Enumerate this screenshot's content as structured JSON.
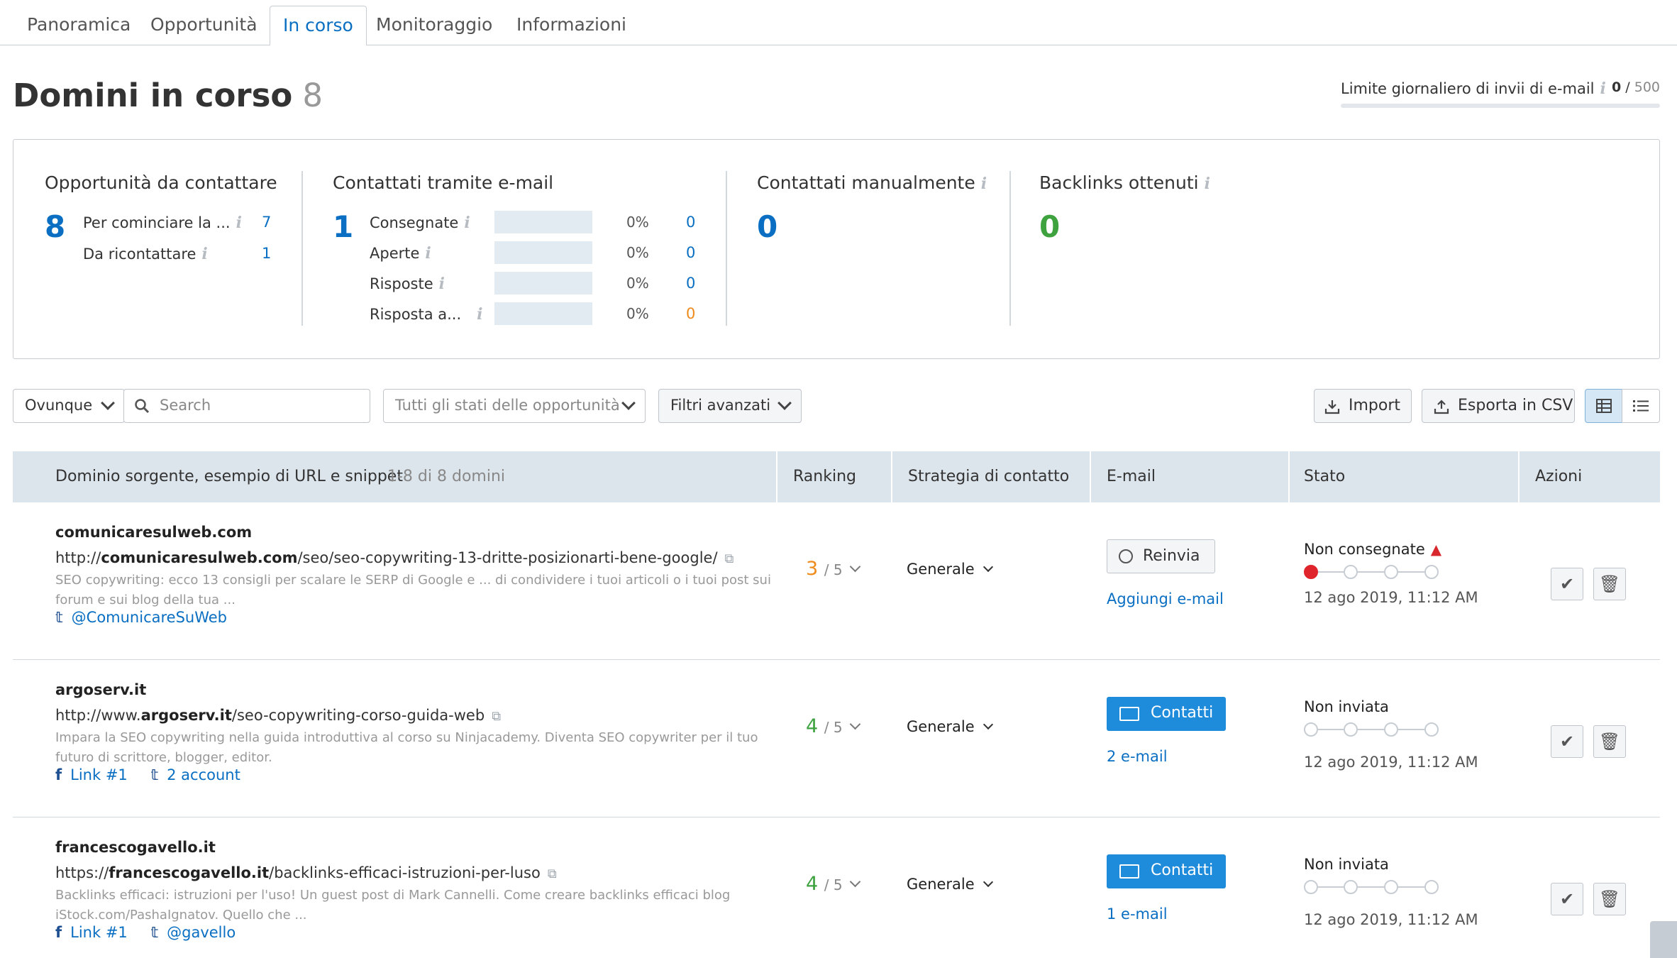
{
  "tabs": [
    "Panoramica",
    "Opportunità",
    "In corso",
    "Monitoraggio",
    "Informazioni"
  ],
  "active_tab": "In corso",
  "header": {
    "title": "Domini in corso",
    "count": "8"
  },
  "email_limit": {
    "label": "Limite giornaliero di invii di e-mail",
    "used": "0",
    "separator": "/",
    "total": "500",
    "progress": 0
  },
  "summary": {
    "opportunities": {
      "title": "Opportunità da contattare",
      "count": "8",
      "rows": [
        {
          "label": "Per cominciare la ...",
          "value": "7"
        },
        {
          "label": "Da ricontattare",
          "value": "1"
        }
      ]
    },
    "email_contacted": {
      "title": "Contattati tramite e-mail",
      "count": "1",
      "rows": [
        {
          "label": "Consegnate",
          "pct": "0%",
          "value": "0"
        },
        {
          "label": "Aperte",
          "pct": "0%",
          "value": "0"
        },
        {
          "label": "Risposte",
          "pct": "0%",
          "value": "0"
        },
        {
          "label": "Risposta a...",
          "pct": "0%",
          "value": "0"
        }
      ]
    },
    "manual": {
      "title": "Contattati manualmente",
      "count": "0"
    },
    "backlinks": {
      "title": "Backlinks ottenuti",
      "count": "0"
    }
  },
  "filters": {
    "location": "Ovunque",
    "search_placeholder": "Search",
    "status": "Tutti gli stati delle opportunità",
    "advanced": "Filtri avanzati",
    "import": "Import",
    "export": "Esporta in CSV"
  },
  "table": {
    "headers": {
      "domain": "Dominio sorgente, esempio di URL e snippet",
      "range": "1-8 di 8 domini",
      "ranking": "Ranking",
      "strategy": "Strategia di contatto",
      "email": "E-mail",
      "status": "Stato",
      "actions": "Azioni"
    },
    "rows": [
      {
        "domain": "comunicaresulweb.com",
        "url_prefix": "http://",
        "url_domain": "comunicaresulweb.com",
        "url_path": "/seo/seo-copywriting-13-dritte-posizionarti-bene-google/",
        "snippet": "SEO copywriting: ecco 13 consigli per scalare le SERP di Google e ... di condividere i tuoi articoli o i tuoi post sui forum e sui blog della tua ...",
        "social": [
          {
            "icon": "twitter-icon",
            "glyph": "𝕥",
            "label": "@ComunicareSuWeb"
          }
        ],
        "ranking": "3",
        "ranking_of": "/ 5",
        "strategy": "Generale",
        "email_button": "Reinvia",
        "email_button_style": "white",
        "email_link": "Aggiungi e-mail",
        "status": "Non consegnate",
        "status_warning": true,
        "status_step": 1,
        "date": "12 ago 2019, 11:12 AM"
      },
      {
        "domain": "argoserv.it",
        "url_prefix": "http://www.",
        "url_domain": "argoserv.it",
        "url_path": "/seo-copywriting-corso-guida-web",
        "snippet": "Impara la SEO copywriting nella guida introduttiva al corso su Ninjacademy. Diventa SEO copywriter per il tuo futuro di scrittore, blogger, editor.",
        "social": [
          {
            "icon": "facebook-icon",
            "glyph": "f",
            "label": "Link #1"
          },
          {
            "icon": "twitter-icon",
            "glyph": "𝕥",
            "label": "2 account"
          }
        ],
        "ranking": "4",
        "ranking_of": "/ 5",
        "strategy": "Generale",
        "email_button": "Contatti",
        "email_button_style": "blue",
        "email_link": "2 e-mail",
        "status": "Non inviata",
        "status_warning": false,
        "status_step": 0,
        "date": "12 ago 2019, 11:12 AM"
      },
      {
        "domain": "francescogavello.it",
        "url_prefix": "https://",
        "url_domain": "francescogavello.it",
        "url_path": "/backlinks-efficaci-istruzioni-per-luso",
        "snippet": "Backlinks efficaci: istruzioni per l'uso! Un guest post di Mark Cannelli. Come creare backlinks efficaci blog iStock.com/PashaIgnatov. Quello che ...",
        "social": [
          {
            "icon": "facebook-icon",
            "glyph": "f",
            "label": "Link #1"
          },
          {
            "icon": "twitter-icon",
            "glyph": "𝕥",
            "label": "@gavello"
          }
        ],
        "ranking": "4",
        "ranking_of": "/ 5",
        "strategy": "Generale",
        "email_button": "Contatti",
        "email_button_style": "blue",
        "email_link": "1 e-mail",
        "status": "Non inviata",
        "status_warning": false,
        "status_step": 0,
        "date": "12 ago 2019, 11:12 AM"
      }
    ]
  }
}
